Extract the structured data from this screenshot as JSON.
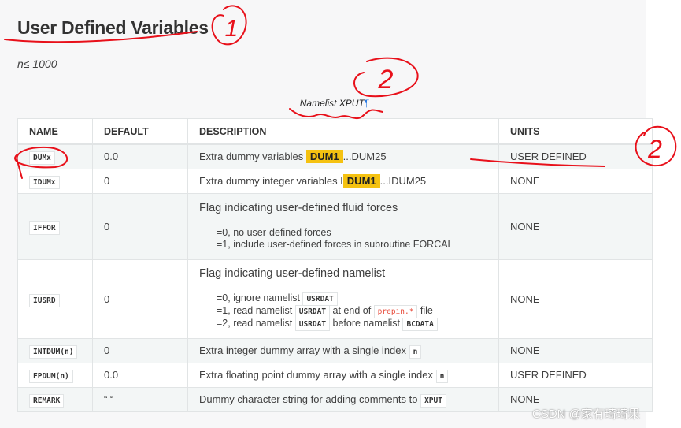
{
  "page": {
    "title": "User Defined Variables",
    "subtitle": "n≤ 1000",
    "caption": "Namelist XPUT",
    "caption_mark": "¶"
  },
  "table": {
    "headers": [
      "NAME",
      "DEFAULT",
      "DESCRIPTION",
      "UNITS"
    ],
    "rows": [
      {
        "name": "DUMx",
        "default": "0.0",
        "desc_pre": "Extra dummy variables ",
        "highlight": "DUM1",
        "desc_post": "...DUM25",
        "units": "USER DEFINED"
      },
      {
        "name": "IDUMx",
        "default": "0",
        "desc_pre": "Extra dummy integer variables I",
        "highlight": "DUM1",
        "desc_post": "...IDUM25",
        "units": "NONE"
      },
      {
        "name": "IFFOR",
        "default": "0",
        "desc_head": "Flag indicating user-defined fluid forces",
        "line1": "=0, no user-defined forces",
        "line2": "=1, include user-defined forces in subroutine FORCAL",
        "units": "NONE"
      },
      {
        "name": "IUSRD",
        "default": "0",
        "desc_head": "Flag indicating user-defined namelist",
        "l1_pre": "=0, ignore namelist ",
        "l1_code": "USRDAT",
        "l2_pre": "=1, read namelist ",
        "l2_code": "USRDAT",
        "l2_mid": " at end of ",
        "l2_code2": "prepin.*",
        "l2_post": " file",
        "l3_pre": "=2, read namelist ",
        "l3_code": "USRDAT",
        "l3_mid": " before namelist ",
        "l3_code2": "BCDATA",
        "units": "NONE"
      },
      {
        "name": "INTDUM(n)",
        "default": "0",
        "desc_pre": "Extra integer dummy array with a single index ",
        "code": "n",
        "units": "NONE"
      },
      {
        "name": "FPDUM(n)",
        "default": "0.0",
        "desc_pre": "Extra floating point dummy array with a single index ",
        "code": "n",
        "units": "USER DEFINED"
      },
      {
        "name": "REMARK",
        "default": "“ “",
        "desc_pre": "Dummy character string for adding comments to ",
        "code": "XPUT",
        "units": "NONE"
      }
    ]
  },
  "annotations": {
    "mark1": "1",
    "mark2": "2",
    "mark3": "2",
    "color": "#e8101a"
  },
  "watermark": "CSDN @家有琦琦果"
}
